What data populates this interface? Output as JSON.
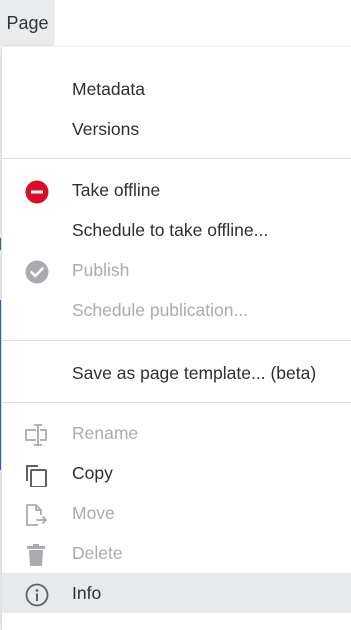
{
  "toolbar": {
    "page_label": "Page"
  },
  "menu": {
    "items": [
      {
        "label": "Metadata",
        "icon": "none",
        "enabled": true
      },
      {
        "label": "Versions",
        "icon": "none",
        "enabled": true
      },
      {
        "label": "Take offline",
        "icon": "minus-circle-icon",
        "enabled": true
      },
      {
        "label": "Schedule to take offline...",
        "icon": "none",
        "enabled": true
      },
      {
        "label": "Publish",
        "icon": "check-circle-icon",
        "enabled": false
      },
      {
        "label": "Schedule publication...",
        "icon": "none",
        "enabled": false
      },
      {
        "label": "Save as page template... (beta)",
        "icon": "none",
        "enabled": true
      },
      {
        "label": "Rename",
        "icon": "rename-icon",
        "enabled": false
      },
      {
        "label": "Copy",
        "icon": "copy-icon",
        "enabled": true
      },
      {
        "label": "Move",
        "icon": "move-icon",
        "enabled": false
      },
      {
        "label": "Delete",
        "icon": "trash-icon",
        "enabled": false
      },
      {
        "label": "Info",
        "icon": "info-icon",
        "enabled": true,
        "highlighted": true
      }
    ]
  },
  "colors": {
    "danger": "#d90d2a",
    "disabled": "#a9abae",
    "text": "#2d2f31",
    "highlight": "#e7eaed"
  }
}
